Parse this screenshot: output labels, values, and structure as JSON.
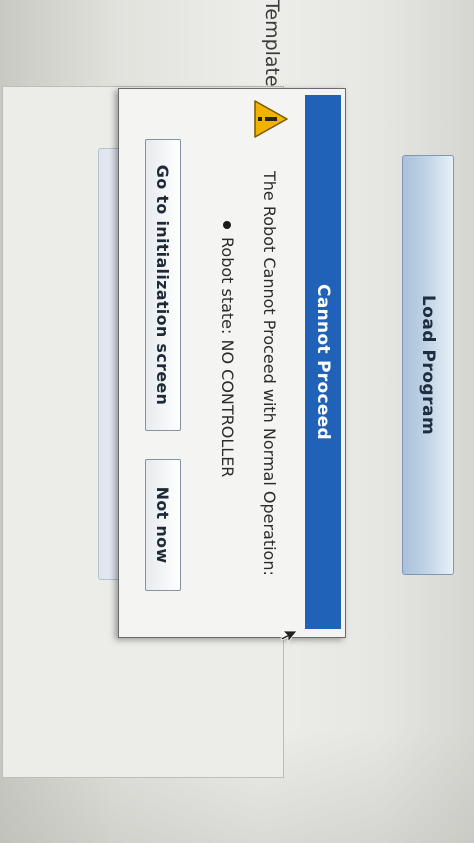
{
  "background": {
    "side_label": "Template",
    "load_button_label": "Load Program"
  },
  "dialog": {
    "title": "Cannot Proceed",
    "message": "The Robot Cannot Proceed with Normal Operation:",
    "details": [
      "Robot state: NO CONTROLLER"
    ],
    "buttons": {
      "primary": "Go to initialization screen",
      "secondary": "Not now"
    },
    "icon": "warning-icon"
  },
  "colors": {
    "title_bar": "#1f62b8",
    "warning": "#f0b400"
  }
}
